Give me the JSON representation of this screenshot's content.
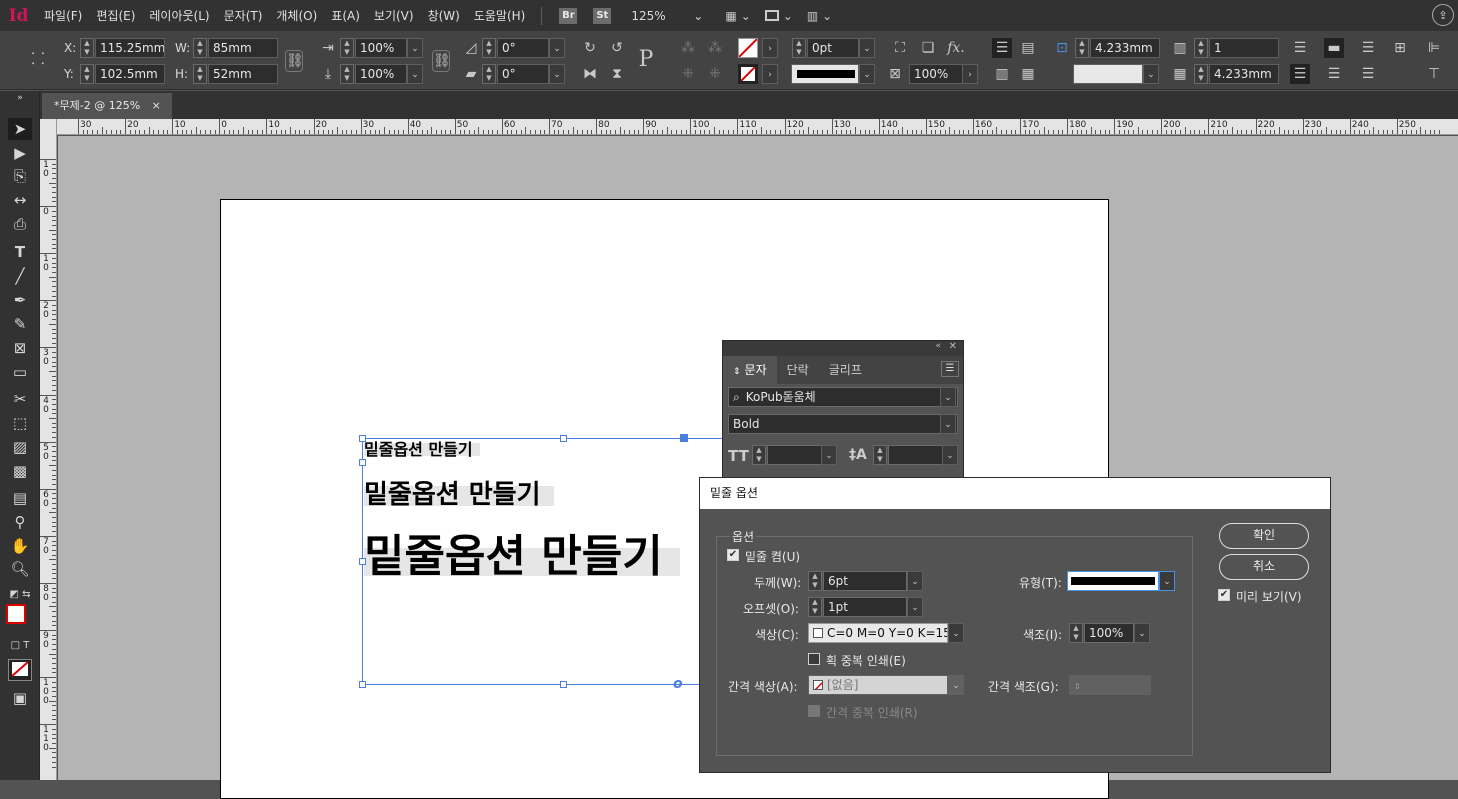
{
  "app": {
    "logo": "Id"
  },
  "menu": [
    "파일(F)",
    "편집(E)",
    "레이아웃(L)",
    "문자(T)",
    "개체(O)",
    "표(A)",
    "보기(V)",
    "창(W)",
    "도움말(H)"
  ],
  "bridge": {
    "br": "Br",
    "st": "St"
  },
  "zoom": "125%",
  "control": {
    "x_label": "X:",
    "x_value": "115.25mm",
    "y_label": "Y:",
    "y_value": "102.5mm",
    "w_label": "W:",
    "w_value": "85mm",
    "h_label": "H:",
    "h_value": "52mm",
    "scale_x": "100%",
    "scale_y": "100%",
    "rotate": "0°",
    "shear": "0°",
    "stroke_weight": "0pt",
    "opacity": "100%",
    "col_gutter": "4.233mm",
    "col_count": "1",
    "col_width": "4.233mm"
  },
  "document_tab": {
    "label": "*무제-2 @ 125%",
    "close": "×"
  },
  "ruler": {
    "h_labels": [
      "30",
      "20",
      "10",
      "0",
      "10",
      "20",
      "30",
      "40",
      "50",
      "60",
      "70",
      "80",
      "90",
      "100",
      "110",
      "120",
      "130",
      "140",
      "150",
      "160",
      "170",
      "180",
      "190",
      "200",
      "210",
      "220",
      "230",
      "240",
      "250"
    ],
    "v_labels": [
      "1 0",
      "0",
      "1 0",
      "2 0",
      "3 0",
      "4 0",
      "5 0",
      "6 0",
      "7 0",
      "8 0",
      "9 0",
      "1 0 0",
      "1 1 0"
    ]
  },
  "canvas": {
    "samples": [
      "밑줄옵션 만들기",
      "밑줄옵션 만들기",
      "밑줄옵션 만들기"
    ]
  },
  "char_panel": {
    "tabs": [
      "문자",
      "단락",
      "글리프"
    ],
    "font_family": "KoPub돋움체",
    "font_style": "Bold"
  },
  "dialog": {
    "title": "밑줄 옵션",
    "group_label": "옵션",
    "underline_on": "밑줄 켬(U)",
    "weight_label": "두께(W):",
    "weight": "6pt",
    "type_label": "유형(T):",
    "offset_label": "오프셋(O):",
    "offset": "1pt",
    "color_label": "색상(C):",
    "color": "C=0 M=0 Y=0 K=15",
    "tint_label": "색조(I):",
    "tint": "100%",
    "overprint_stroke": "획 중복 인쇄(E)",
    "gap_color_label": "간격 색상(A):",
    "gap_color": "[없음]",
    "gap_tint_label": "간격 색조(G):",
    "overprint_gap": "간격 중복 인쇄(R)",
    "ok": "확인",
    "cancel": "취소",
    "preview": "미리 보기(V)"
  }
}
